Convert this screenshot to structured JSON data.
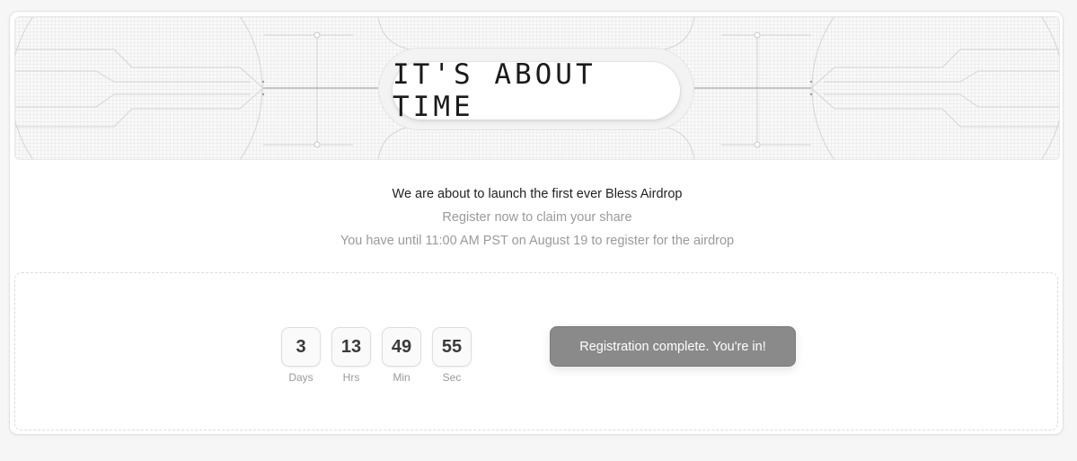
{
  "banner": {
    "title": "IT'S ABOUT TIME"
  },
  "messages": {
    "headline": "We are about to launch the first ever Bless Airdrop",
    "subline": "Register now to claim your share",
    "deadline": "You have until 11:00 AM PST on August 19 to register for the airdrop"
  },
  "countdown": {
    "days": {
      "value": "3",
      "label": "Days"
    },
    "hours": {
      "value": "13",
      "label": "Hrs"
    },
    "minutes": {
      "value": "49",
      "label": "Min"
    },
    "seconds": {
      "value": "55",
      "label": "Sec"
    }
  },
  "registration": {
    "button_label": "Registration complete. You're in!"
  },
  "colors": {
    "page_background": "#f6f6f6",
    "button_background": "#8a8a8a",
    "text_primary": "#1f1f1f",
    "text_secondary": "#9a9a9a"
  }
}
